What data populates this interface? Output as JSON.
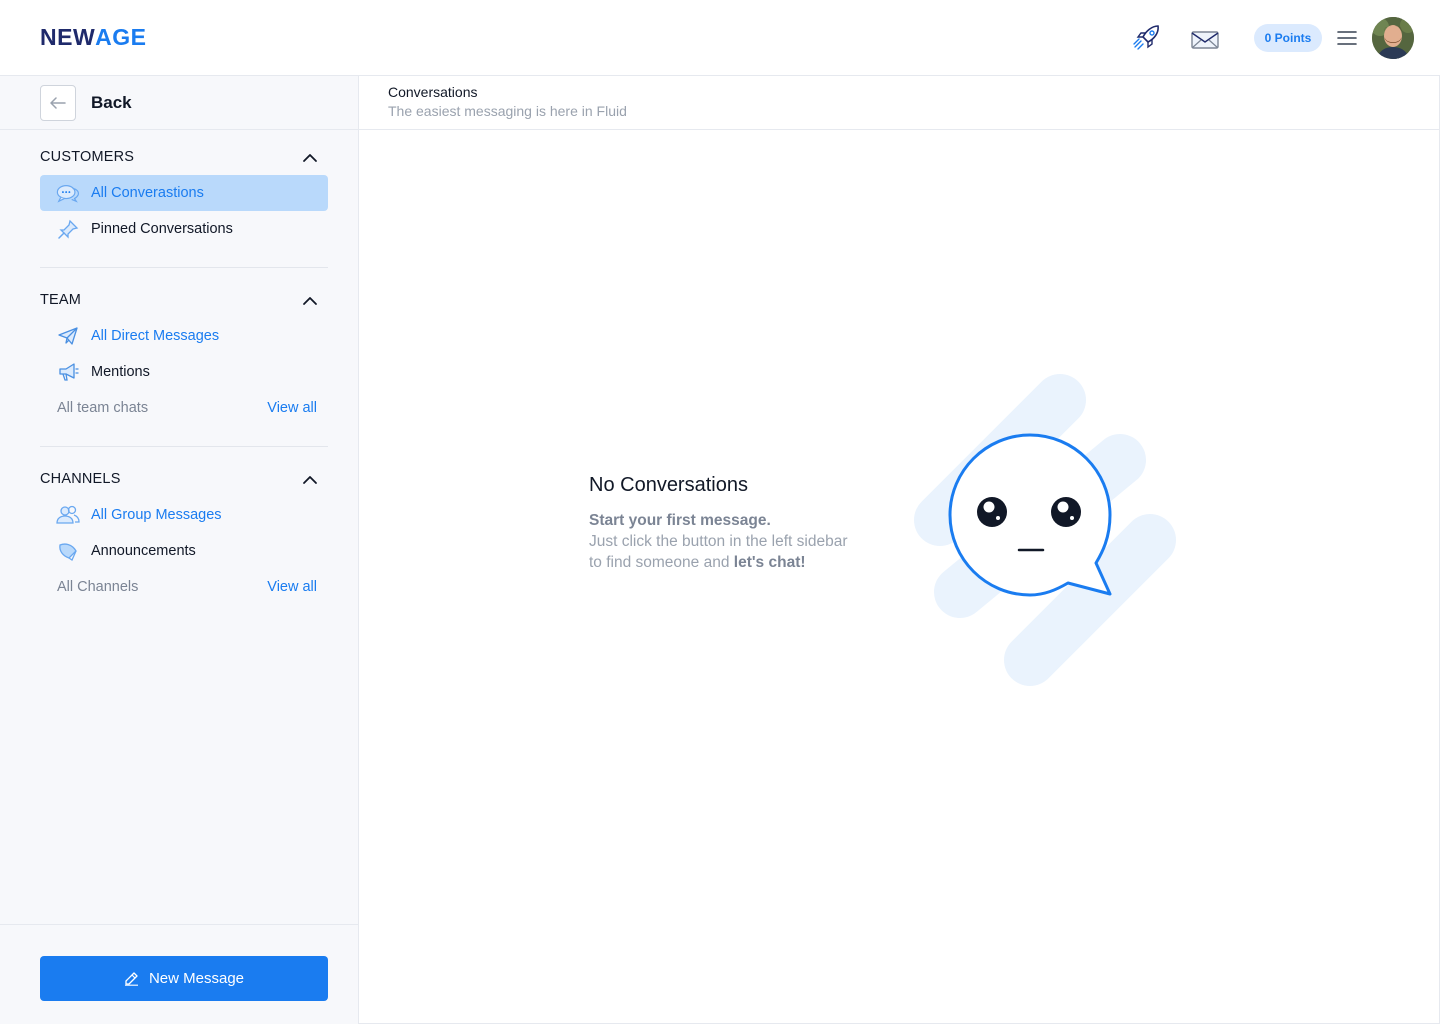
{
  "app": {
    "logo_part1": "NEW",
    "logo_part2": "AGE",
    "points_label": "0 Points",
    "icons": [
      "rocket-icon",
      "mail-icon",
      "menu-icon"
    ],
    "accent_color": "#1a7cf0"
  },
  "sidebar": {
    "back_label": "Back",
    "sections": [
      {
        "title": "CUSTOMERS",
        "items": [
          {
            "label": "All Converastions",
            "icon": "chat-bubbles-icon",
            "active": true
          },
          {
            "label": "Pinned Conversations",
            "icon": "pin-icon",
            "active": false
          }
        ]
      },
      {
        "title": "TEAM",
        "items": [
          {
            "label": "All Direct Messages",
            "icon": "paper-plane-icon"
          },
          {
            "label": "Mentions",
            "icon": "megaphone-icon"
          }
        ],
        "footer": {
          "label": "All team chats",
          "link": "View all"
        }
      },
      {
        "title": "CHANNELS",
        "items": [
          {
            "label": "All Group Messages",
            "icon": "group-icon"
          },
          {
            "label": "Announcements",
            "icon": "announcement-icon"
          }
        ],
        "footer": {
          "label": "All Channels",
          "link": "View all"
        }
      }
    ],
    "new_message_label": "New Message"
  },
  "main": {
    "title": "Conversations",
    "subtitle": "The easiest messaging is here in Fluid",
    "empty": {
      "title": "No Conversations",
      "line1": "Start your first message.",
      "line2": "Just click the button in the left sidebar",
      "line3_prefix": "to find someone and ",
      "line3_bold": "let's chat!"
    }
  }
}
